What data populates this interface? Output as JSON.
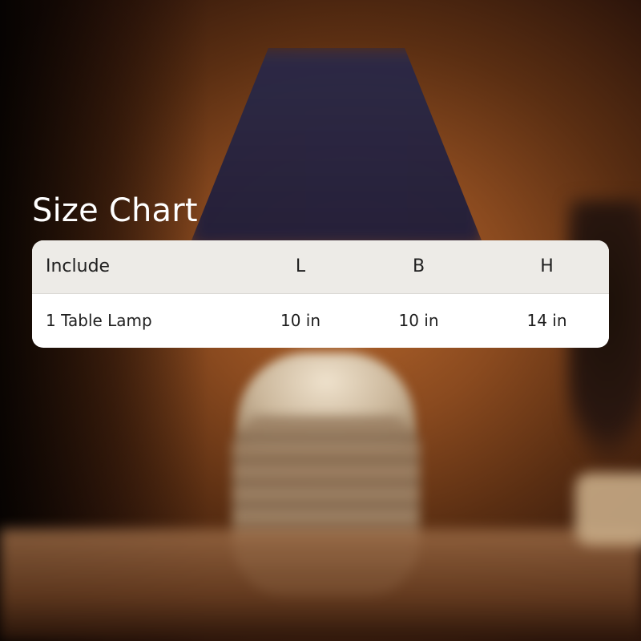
{
  "title": "Size Chart",
  "table": {
    "headers": [
      "Include",
      "L",
      "B",
      "H"
    ],
    "rows": [
      [
        "1 Table Lamp",
        "10 in",
        "10 in",
        "14 in"
      ]
    ]
  }
}
